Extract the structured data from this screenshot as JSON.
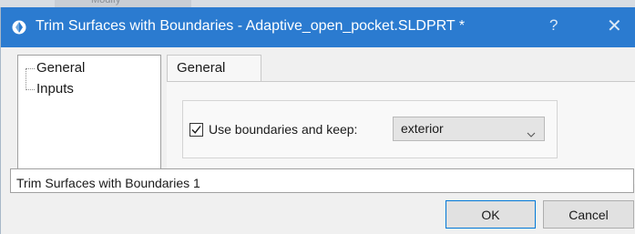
{
  "background": {
    "ghost_text": "Modify"
  },
  "window": {
    "title": "Trim Surfaces with Boundaries - Adaptive_open_pocket.SLDPRT *",
    "help_glyph": "?",
    "close_glyph": "✕",
    "titlebar_color": "#2b7bd0"
  },
  "tree": {
    "items": [
      {
        "label": "General",
        "selected": true
      },
      {
        "label": "Inputs",
        "selected": false
      }
    ]
  },
  "tabs": [
    {
      "label": "General",
      "active": true
    }
  ],
  "general": {
    "use_boundaries_checked": true,
    "use_boundaries_label": "Use boundaries and keep:",
    "keep_select_value": "exterior"
  },
  "name_field": {
    "value": "Trim Surfaces with Boundaries 1"
  },
  "buttons": {
    "ok_label": "OK",
    "cancel_label": "Cancel",
    "ok_border_color": "#0078d7"
  }
}
